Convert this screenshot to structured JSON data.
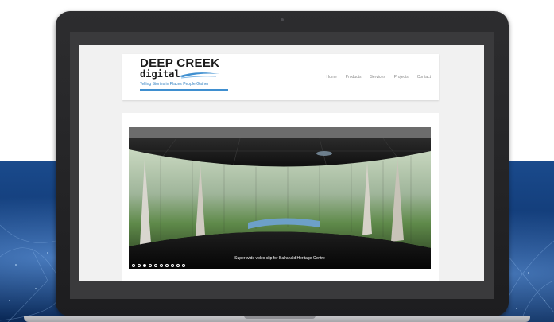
{
  "colors": {
    "accent_blue": "#3f8fd0",
    "nav_text": "#8a8a8a",
    "bezel": "#1d1d1f",
    "background_band": "#0f3670"
  },
  "site": {
    "logo": {
      "title": "DEEP CREEK",
      "subtitle": "digital",
      "tagline": "Telling Stories in Places People Gather",
      "swoosh_icon": "swoosh-icon"
    },
    "nav": [
      {
        "label": "Home"
      },
      {
        "label": "Products"
      },
      {
        "label": "Services"
      },
      {
        "label": "Projects"
      },
      {
        "label": "Contact"
      }
    ],
    "slider": {
      "caption": "Super wide video clip for Balranald Heritage Centre",
      "slide_count": 10,
      "active_index": 2
    }
  }
}
